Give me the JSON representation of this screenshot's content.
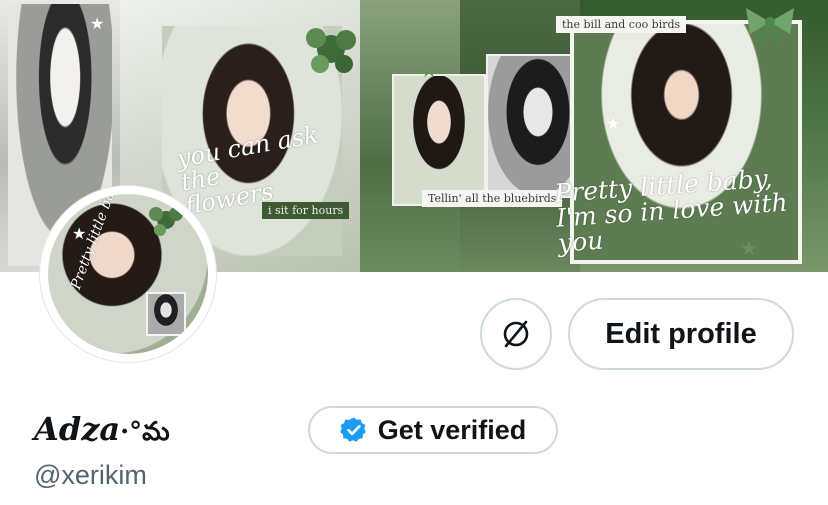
{
  "banner": {
    "tag_top": "the bill and coo birds",
    "tag_sit": "i sit for hours",
    "tag_blue": "Tellin' all the bluebirds",
    "script_flowers": "you can ask the\nflowers",
    "script_pretty": "Pretty little baby,\nI'm so in love with\nyou"
  },
  "avatar": {
    "script": "Pretty little baby"
  },
  "actions": {
    "edit_profile": "Edit profile",
    "get_verified": "Get verified"
  },
  "profile": {
    "display_name": "Adza",
    "name_deco": "·°మ",
    "handle": "@xerikim"
  },
  "icons": {
    "link_icon": "linked-circle-icon",
    "verified_icon": "verified-badge-icon"
  },
  "colors": {
    "verified_blue": "#1d9bf0",
    "text": "#0f1419",
    "muted": "#536471",
    "border": "#cfd9de"
  }
}
